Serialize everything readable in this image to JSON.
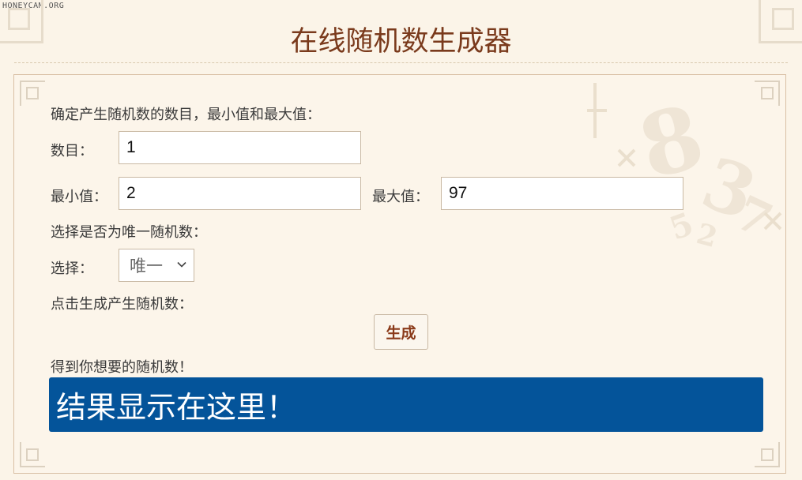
{
  "watermark": "HONEYCAM.ORG",
  "page": {
    "title": "在线随机数生成器"
  },
  "form": {
    "intro": "确定产生随机数的数目，最小值和最大值：",
    "count_label": "数目：",
    "count_value": "1",
    "min_label": "最小值：",
    "min_value": "2",
    "max_label": "最大值：",
    "max_value": "97",
    "unique_prompt": "选择是否为唯一随机数：",
    "select_label": "选择：",
    "select_value": "唯一",
    "generate_prompt": "点击生成产生随机数：",
    "generate_button": "生成",
    "result_prompt": "得到你想要的随机数！",
    "result_text": "结果显示在这里！"
  },
  "colors": {
    "background": "#fbf4e8",
    "title": "#7a3a1c",
    "result_bg": "#04549a",
    "button_text": "#8a3a1a"
  },
  "decorations": {
    "panel_background_digits": [
      "8",
      "3",
      "7",
      "5",
      "2"
    ]
  }
}
